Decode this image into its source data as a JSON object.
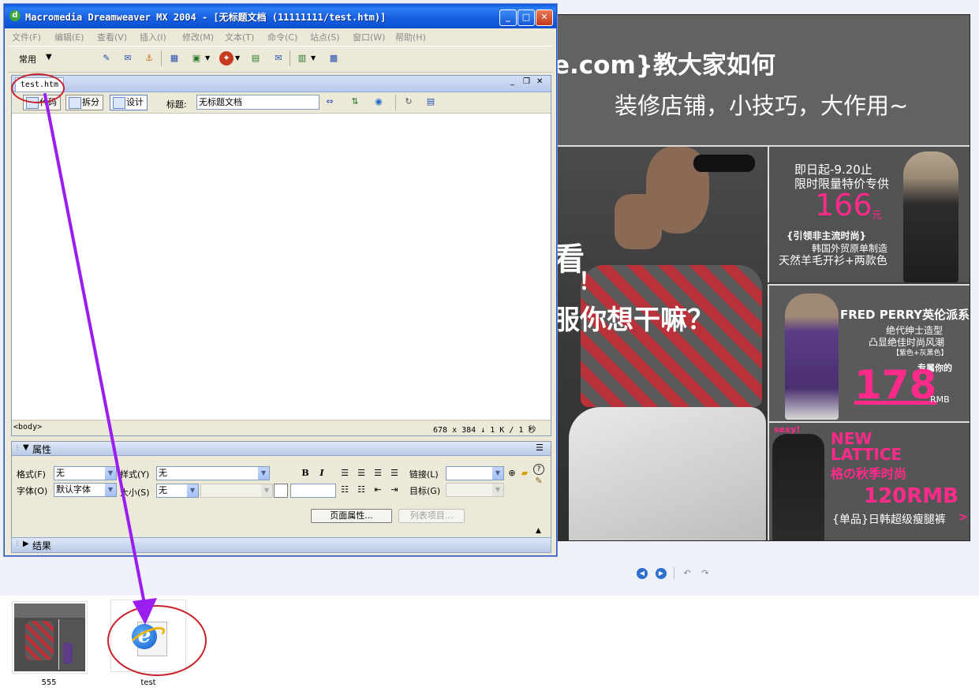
{
  "dreamweaver": {
    "window_title": "Macromedia Dreamweaver MX 2004 - [无标题文档 (11111111/test.htm)]",
    "window_controls": {
      "minimize": "_",
      "maximize": "□",
      "close": "✕"
    },
    "menu": [
      "文件(F)",
      "编辑(E)",
      "查看(V)",
      "插入(I)",
      "修改(M)",
      "文本(T)",
      "命令(C)",
      "站点(S)",
      "窗口(W)",
      "帮助(H)"
    ],
    "insert_bar": {
      "category": "常用"
    },
    "document": {
      "tab_name": "test.htm",
      "views": {
        "code": "代码",
        "split": "拆分",
        "design": "设计"
      },
      "title_label": "标题:",
      "title_value": "无标题文档",
      "tag_selector": "<body>",
      "size_info": "678 x 384 ↓ 1 K / 1 秒"
    },
    "properties": {
      "header": "属性",
      "format_label": "格式(F)",
      "format_value": "无",
      "style_label": "样式(Y)",
      "style_value": "无",
      "bold": "B",
      "italic": "I",
      "link_label": "链接(L)",
      "font_label": "字体(O)",
      "font_value": "默认字体",
      "size_label": "大小(S)",
      "size_value": "无",
      "target_label": "目标(G)",
      "page_props_button": "页面属性...",
      "list_item_button": "列表项目...",
      "help": "?"
    },
    "results_panel": {
      "header": "结果"
    }
  },
  "banner": {
    "headline": "e.com}教大家如何",
    "subline": "装修店铺，小技巧，大作用~",
    "left_fragment_1": "看",
    "left_fragment_2": "！",
    "left_fragment_3": "服你想干嘛？",
    "panel1": {
      "date_line": "即日起-9.20止",
      "promo_line": "限时限量特价专供",
      "price": "166",
      "price_unit": "元",
      "tag_line": "{引领非主流时尚}",
      "desc1": "韩国外贸原单制造",
      "desc2": "天然羊毛开衫+两款色"
    },
    "panel2": {
      "title": "FRED PERRY英伦派系",
      "desc1": "绝代绅士造型",
      "desc2": "凸显绝佳时尚风潮",
      "colors": "【紫色+灰黑色】",
      "exclusive": "专属你的",
      "price": "178",
      "unit": "RMB"
    },
    "panel3": {
      "badge": "sexy!",
      "title1": "NEW",
      "title2": "LATTICE",
      "subtitle": "格の秋季时尚",
      "price": "120RMB",
      "desc": "{单品}日韩超级瘦腿裤",
      "arrow": ">"
    }
  },
  "viewer_controls": {
    "prev": "◀",
    "next": "▶",
    "rotate_left": "↶",
    "rotate_right": "↷"
  },
  "thumbnails": [
    {
      "name": "555",
      "kind": "image"
    },
    {
      "name": "test",
      "kind": "ie-html-file",
      "icon_letter": "e"
    }
  ],
  "colors": {
    "xp_titlebar": "#0a5fe6",
    "annotation_arrow": "#9b1ef0",
    "annotation_ellipse": "#c8202a",
    "banner_pink": "#ff2a8a"
  }
}
